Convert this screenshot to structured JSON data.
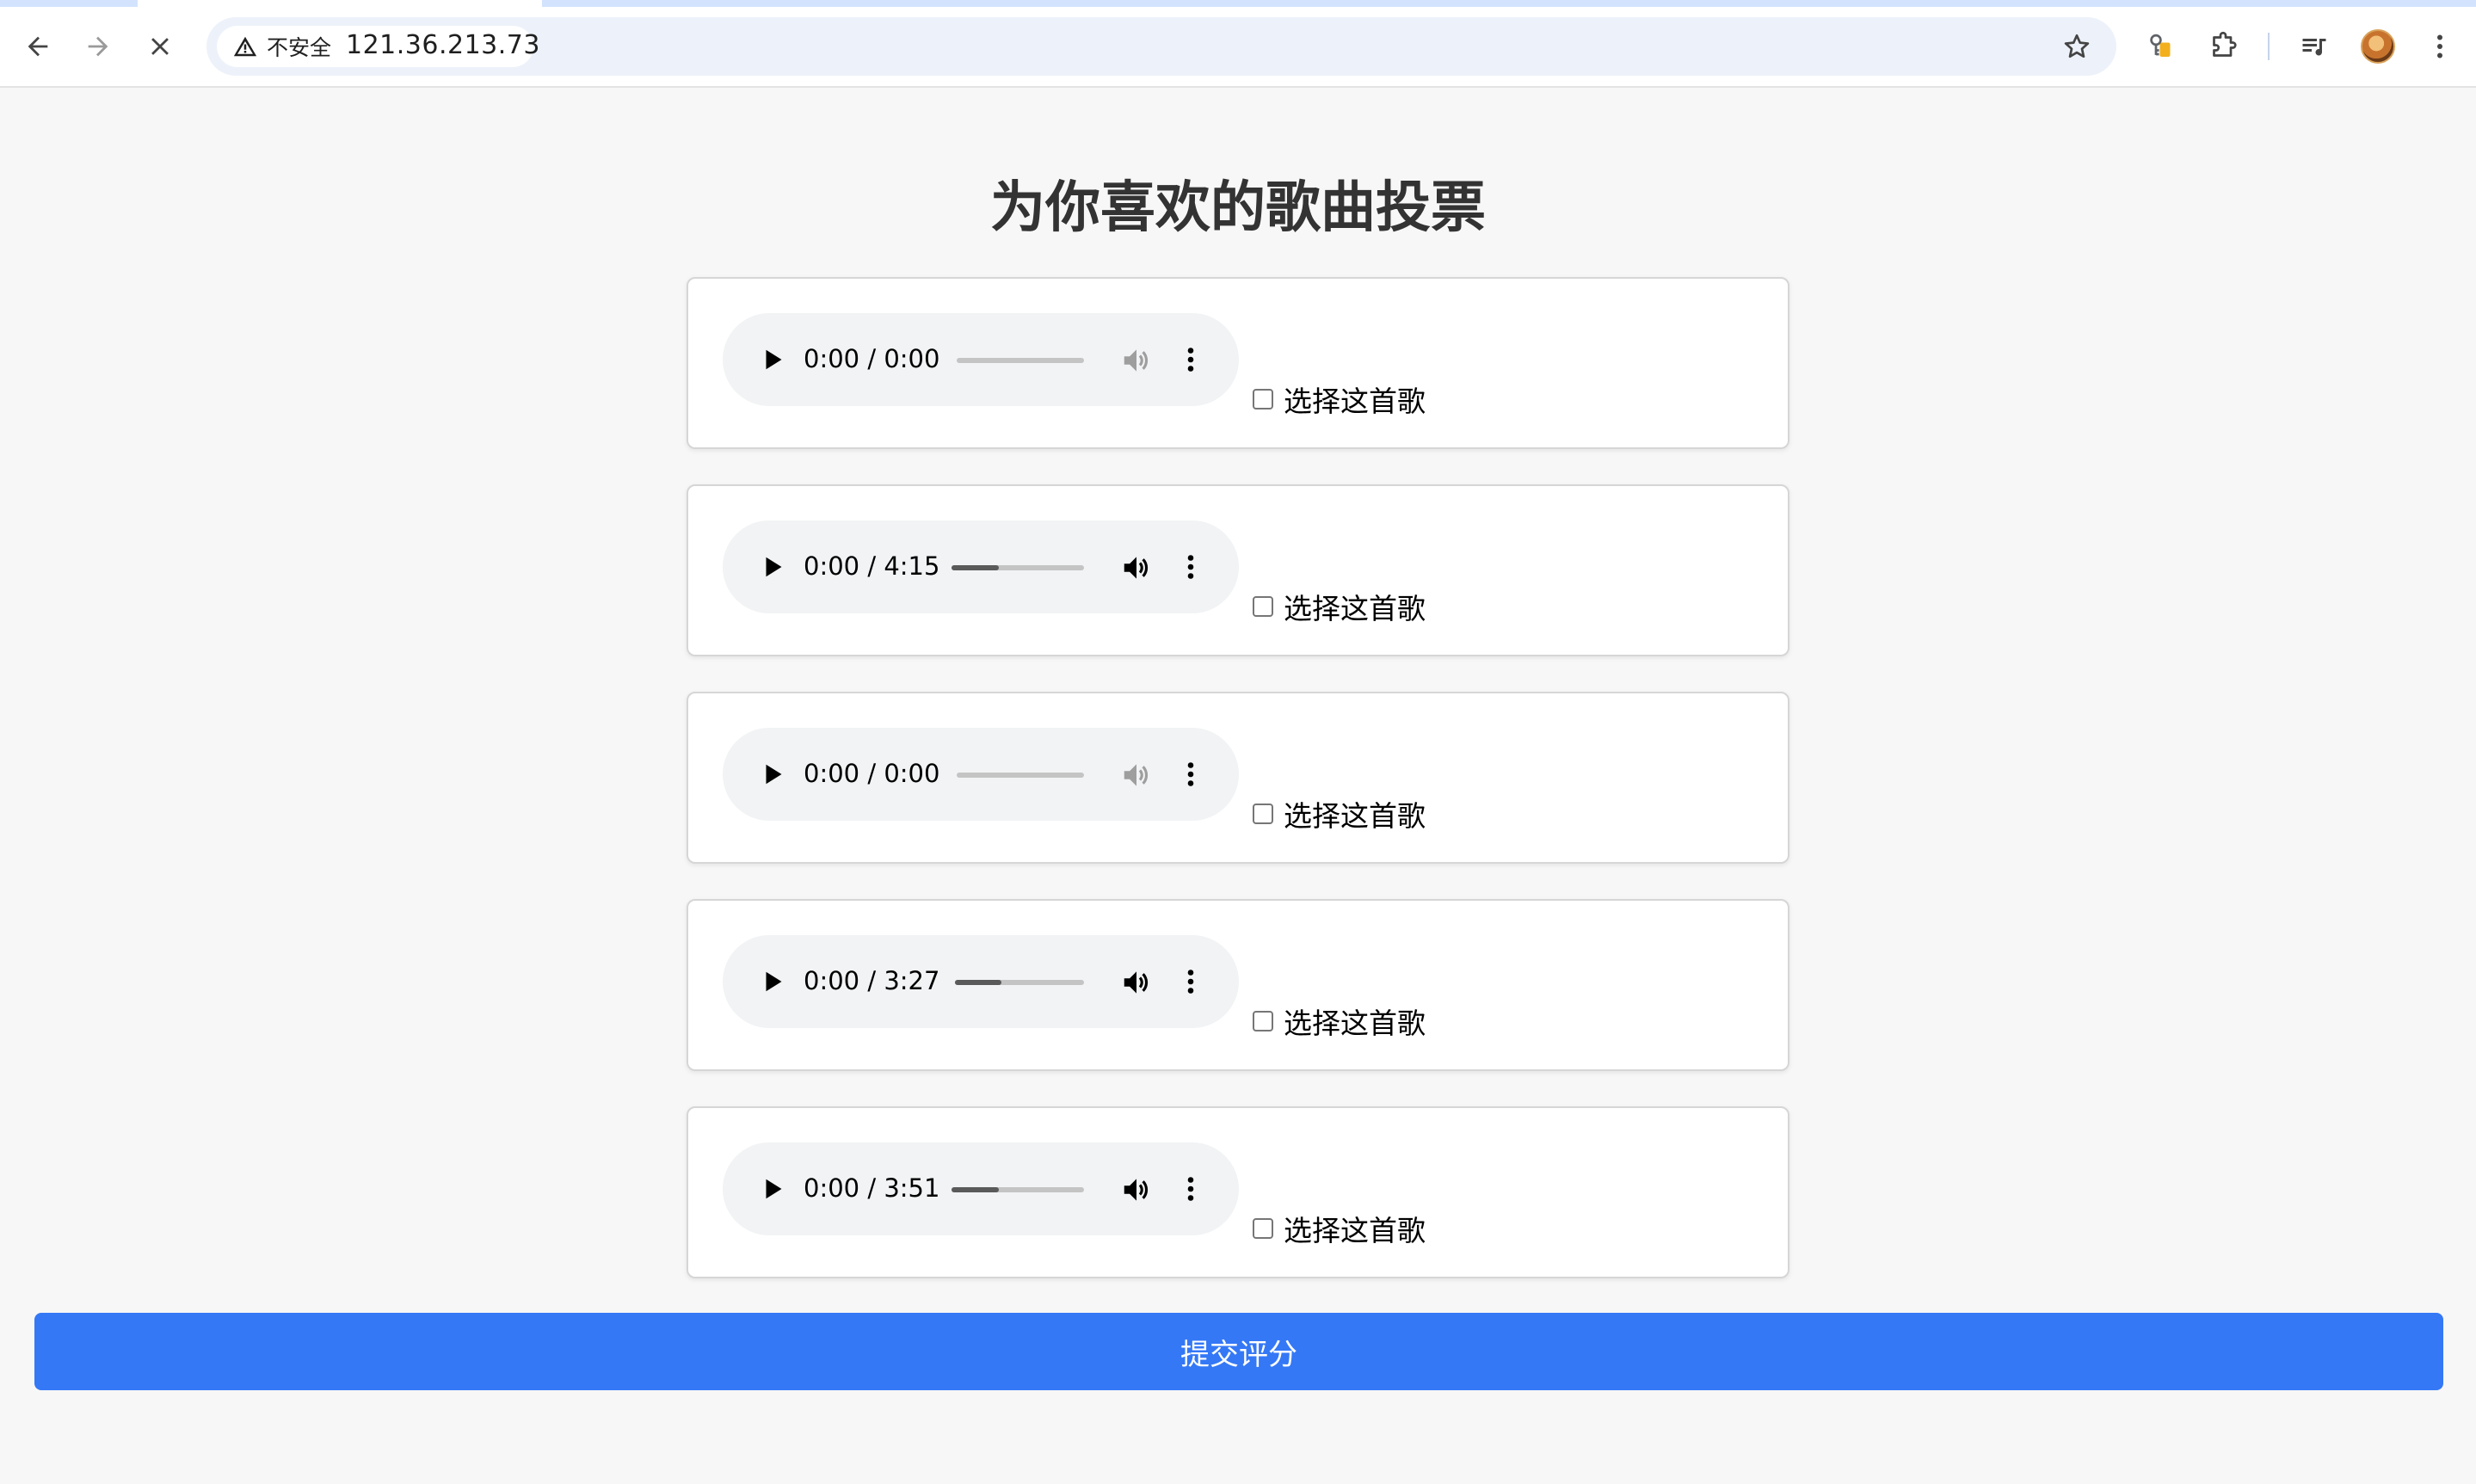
{
  "browser": {
    "security_label": "不安全",
    "url": "121.36.213.73"
  },
  "page": {
    "title": "为你喜欢的歌曲投票",
    "songs": [
      {
        "time": "0:00 / 0:00",
        "playback_fraction": 0,
        "volume_enabled": false,
        "select_label": "选择这首歌",
        "checked": false
      },
      {
        "time": "0:00 / 4:15",
        "playback_fraction": 0,
        "volume_enabled": true,
        "select_label": "选择这首歌",
        "checked": false
      },
      {
        "time": "0:00 / 0:00",
        "playback_fraction": 0,
        "volume_enabled": false,
        "select_label": "选择这首歌",
        "checked": false
      },
      {
        "time": "0:00 / 3:27",
        "playback_fraction": 0,
        "volume_enabled": true,
        "select_label": "选择这首歌",
        "checked": false
      },
      {
        "time": "0:00 / 3:51",
        "playback_fraction": 0,
        "volume_enabled": true,
        "select_label": "选择这首歌",
        "checked": false
      }
    ],
    "submit_label": "提交评分"
  },
  "colors": {
    "accent": "#3478f6",
    "title_text": "#333333",
    "page_bg": "#f7f7f7"
  },
  "icons": [
    "back-arrow-icon",
    "forward-arrow-icon",
    "close-icon",
    "warning-icon",
    "star-icon",
    "key-icon",
    "puzzle-icon",
    "media-queue-icon",
    "avatar",
    "more-vert-icon",
    "play-icon",
    "volume-icon"
  ]
}
